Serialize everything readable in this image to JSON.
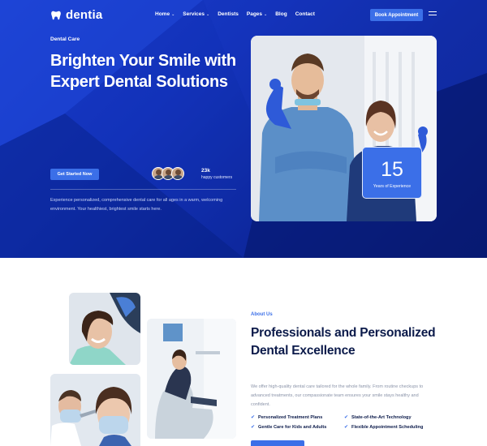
{
  "brand": {
    "name": "dentia",
    "accent": "#3b6fe8",
    "navy": "#0b1a4a"
  },
  "nav": {
    "items": [
      {
        "label": "Home",
        "dropdown": true
      },
      {
        "label": "Services",
        "dropdown": true
      },
      {
        "label": "Dentists",
        "dropdown": false
      },
      {
        "label": "Pages",
        "dropdown": true
      },
      {
        "label": "Blog",
        "dropdown": false
      },
      {
        "label": "Contact",
        "dropdown": false
      }
    ],
    "cta_label": "Book Appointment",
    "icons": {
      "logo": "tooth-icon",
      "menu": "hamburger-icon",
      "caret": "chevron-down-icon"
    }
  },
  "hero": {
    "eyebrow": "Dental Care",
    "title": "Brighten Your Smile with Expert Dental Solutions",
    "cta_label": "Get Started Now",
    "customers_count": "23k",
    "customers_label": "happy customers",
    "description": "Experience personalized, comprehensive dental care for all ages in a warm, welcoming environment. Your healthiest, brightest smile starts here.",
    "stat": {
      "number": "15",
      "label": "Years of Experience"
    }
  },
  "about": {
    "eyebrow": "About Us",
    "title": "Professionals and Personalized Dental Excellence",
    "description": "We offer high-quality dental care tailored for the whole family. From routine checkups to advanced treatments, our compassionate team ensures your smile stays healthy and confident.",
    "features": [
      "Personalized Treatment Plans",
      "State-of-the-Art Technology",
      "Gentle Care for Kids and Adults",
      "Flexible Appointment Scheduling"
    ],
    "check_icon": "check-icon"
  }
}
